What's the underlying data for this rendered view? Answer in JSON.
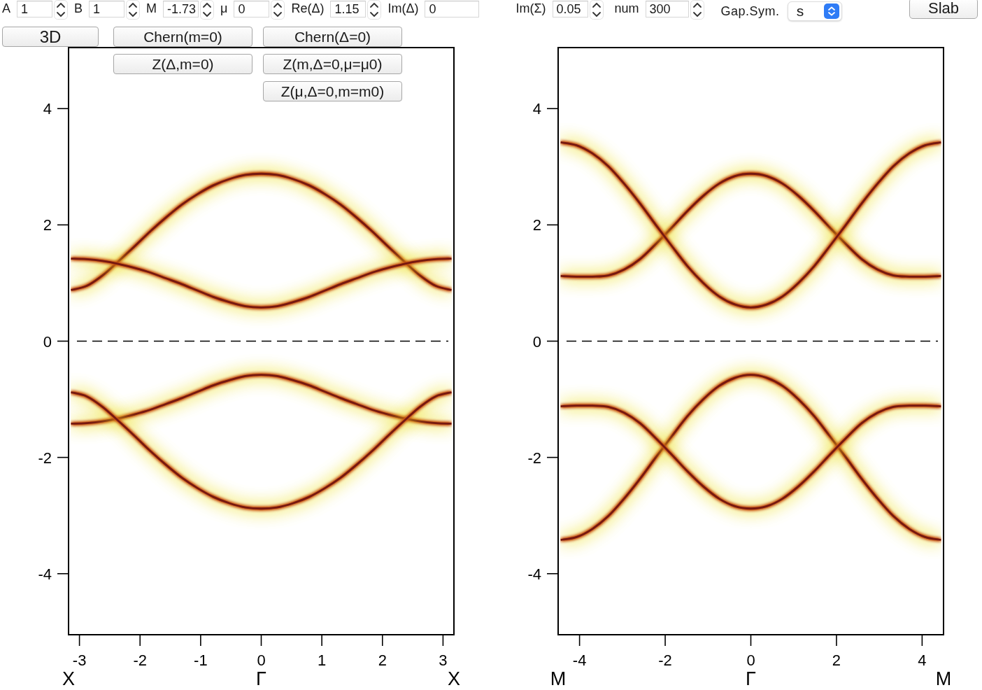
{
  "toolbar": {
    "parameters": [
      {
        "label": "A",
        "value": "1",
        "kind": "spin"
      },
      {
        "label": "B",
        "value": "1",
        "kind": "spin"
      },
      {
        "label": "M",
        "value": "-1.73",
        "kind": "spin"
      },
      {
        "label": "μ",
        "value": "0",
        "kind": "spin"
      },
      {
        "label": "Re(Δ)",
        "value": "1.15",
        "kind": "spin"
      },
      {
        "label": "Im(Δ)",
        "value": "0",
        "kind": "text"
      }
    ],
    "numerics": [
      {
        "label": "Im(Σ)",
        "value": "0.05",
        "kind": "spin"
      },
      {
        "label": "num",
        "value": "300",
        "kind": "spin"
      }
    ],
    "gap_symmetry": {
      "label": "Gap.Sym.",
      "value": "s"
    },
    "slab_button": "Slab"
  },
  "button_columns": [
    [
      "3D"
    ],
    [
      "Chern(m=0)",
      "Z(Δ,m=0)"
    ],
    [
      "Chern(Δ=0)",
      "Z(m,Δ=0,μ=μ0)",
      "Z(μ,Δ=0,m=m0)"
    ]
  ],
  "plots": [
    {
      "chart_data": {
        "type": "line",
        "x": [
          -3.14,
          -2.88,
          -2.62,
          -2.36,
          -2.09,
          -1.83,
          -1.57,
          -1.31,
          -1.05,
          -0.79,
          -0.52,
          -0.26,
          0,
          0.26,
          0.52,
          0.79,
          1.05,
          1.31,
          1.57,
          1.83,
          2.09,
          2.36,
          2.62,
          2.88,
          3.14
        ],
        "series": [
          {
            "values": [
              0.88,
              0.95,
              1.13,
              1.37,
              1.63,
              1.89,
              2.13,
              2.35,
              2.53,
              2.68,
              2.79,
              2.86,
              2.88,
              2.86,
              2.79,
              2.68,
              2.53,
              2.35,
              2.13,
              1.89,
              1.63,
              1.37,
              1.13,
              0.95,
              0.88
            ]
          },
          {
            "values": [
              1.42,
              1.41,
              1.38,
              1.33,
              1.26,
              1.18,
              1.08,
              0.98,
              0.87,
              0.76,
              0.67,
              0.6,
              0.58,
              0.6,
              0.67,
              0.76,
              0.87,
              0.98,
              1.08,
              1.18,
              1.26,
              1.33,
              1.38,
              1.41,
              1.42
            ]
          },
          {
            "values": [
              -1.42,
              -1.41,
              -1.38,
              -1.33,
              -1.26,
              -1.18,
              -1.08,
              -0.98,
              -0.87,
              -0.76,
              -0.67,
              -0.6,
              -0.58,
              -0.6,
              -0.67,
              -0.76,
              -0.87,
              -0.98,
              -1.08,
              -1.18,
              -1.26,
              -1.33,
              -1.38,
              -1.41,
              -1.42
            ]
          },
          {
            "values": [
              -0.88,
              -0.95,
              -1.13,
              -1.37,
              -1.63,
              -1.89,
              -2.13,
              -2.35,
              -2.53,
              -2.68,
              -2.79,
              -2.86,
              -2.88,
              -2.86,
              -2.79,
              -2.68,
              -2.53,
              -2.35,
              -2.13,
              -1.89,
              -1.63,
              -1.37,
              -1.13,
              -0.95,
              -0.88
            ]
          }
        ],
        "xlim": [
          -3.18,
          3.18
        ],
        "ylim": [
          -5.05,
          5.05
        ],
        "xticks": [
          -3,
          -2,
          -1,
          0,
          1,
          2,
          3
        ],
        "yticks": [
          -4,
          -2,
          0,
          2,
          4
        ],
        "ref_lines": [
          {
            "axis": "y",
            "value": 0
          }
        ]
      },
      "path_labels": [
        "X",
        "Γ",
        "X"
      ]
    },
    {
      "chart_data": {
        "type": "line",
        "x": [
          -4.44,
          -4.07,
          -3.7,
          -3.33,
          -2.96,
          -2.59,
          -2.22,
          -1.85,
          -1.48,
          -1.11,
          -0.74,
          -0.37,
          0,
          0.37,
          0.74,
          1.11,
          1.48,
          1.85,
          2.22,
          2.59,
          2.96,
          3.33,
          3.7,
          4.07,
          4.44
        ],
        "series": [
          {
            "values": [
              1.12,
              1.11,
              1.11,
              1.13,
              1.23,
              1.41,
              1.67,
              1.95,
              2.24,
              2.5,
              2.71,
              2.84,
              2.88,
              2.84,
              2.71,
              2.5,
              2.24,
              1.95,
              1.67,
              1.41,
              1.23,
              1.13,
              1.11,
              1.11,
              1.12
            ]
          },
          {
            "values": [
              3.42,
              3.37,
              3.23,
              3.01,
              2.71,
              2.37,
              2.0,
              1.64,
              1.29,
              1.0,
              0.77,
              0.63,
              0.58,
              0.63,
              0.77,
              1.0,
              1.29,
              1.64,
              2.0,
              2.37,
              2.71,
              3.01,
              3.23,
              3.37,
              3.42
            ]
          },
          {
            "values": [
              -3.42,
              -3.37,
              -3.23,
              -3.01,
              -2.71,
              -2.37,
              -2.0,
              -1.64,
              -1.29,
              -1.0,
              -0.77,
              -0.63,
              -0.58,
              -0.63,
              -0.77,
              -1.0,
              -1.29,
              -1.64,
              -2.0,
              -2.37,
              -2.71,
              -3.01,
              -3.23,
              -3.37,
              -3.42
            ]
          },
          {
            "values": [
              -1.12,
              -1.11,
              -1.11,
              -1.13,
              -1.23,
              -1.41,
              -1.67,
              -1.95,
              -2.24,
              -2.5,
              -2.71,
              -2.84,
              -2.88,
              -2.84,
              -2.71,
              -2.5,
              -2.24,
              -1.95,
              -1.67,
              -1.41,
              -1.23,
              -1.13,
              -1.11,
              -1.11,
              -1.12
            ]
          }
        ],
        "xlim": [
          -4.5,
          4.5
        ],
        "ylim": [
          -5.05,
          5.05
        ],
        "xticks": [
          -4,
          -2,
          0,
          2,
          4
        ],
        "yticks": [
          -4,
          -2,
          0,
          2,
          4
        ],
        "ref_lines": [
          {
            "axis": "y",
            "value": 0
          }
        ]
      },
      "path_labels": [
        "M",
        "Γ",
        "M"
      ]
    }
  ]
}
